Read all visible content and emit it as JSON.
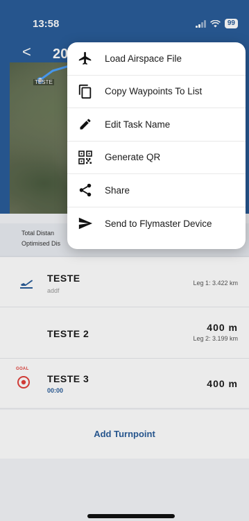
{
  "status_bar": {
    "time": "13:58",
    "battery": "99"
  },
  "header": {
    "back_label": "<",
    "title_fragment": "20"
  },
  "map": {
    "waypoint_label": "TESTE"
  },
  "summary": {
    "total_distance_label": "Total Distan",
    "optimised_distance_label": "Optimised Dis"
  },
  "menu": {
    "items": [
      {
        "label": "Load Airspace File",
        "icon": "airplane-icon"
      },
      {
        "label": "Copy Waypoints To List",
        "icon": "copy-icon"
      },
      {
        "label": "Edit Task Name",
        "icon": "pencil-icon"
      },
      {
        "label": "Generate QR",
        "icon": "qr-icon"
      },
      {
        "label": "Share",
        "icon": "share-icon"
      },
      {
        "label": "Send to Flymaster Device",
        "icon": "send-icon"
      }
    ]
  },
  "waypoints": [
    {
      "name": "TESTE",
      "description": "addf",
      "leg": "Leg 1: 3.422 km",
      "altitude": ""
    },
    {
      "name": "TESTE 2",
      "description": "",
      "leg": "Leg 2: 3.199 km",
      "altitude": "400 m"
    },
    {
      "name": "TESTE 3",
      "description": "00:00",
      "leg": "",
      "altitude": "400 m",
      "badge": "GOAL"
    }
  ],
  "add_turnpoint_label": "Add Turnpoint",
  "colors": {
    "primary": "#2a5d99",
    "goal_red": "#e2413b"
  }
}
